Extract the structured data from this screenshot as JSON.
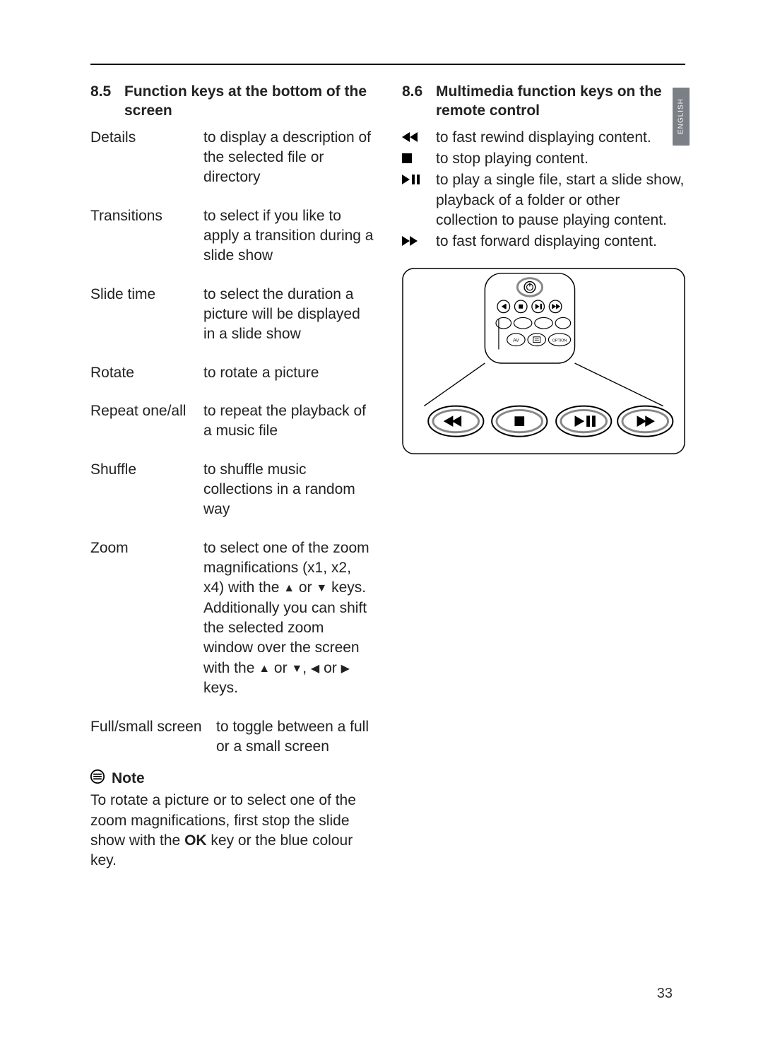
{
  "language_tab": "ENGLISH",
  "page_number": "33",
  "left": {
    "section_number": "8.5",
    "section_title": "Function keys at the bottom of the screen",
    "items": [
      {
        "term": "Details",
        "desc": "to display a description of the selected file or directory"
      },
      {
        "term": "Transitions",
        "desc": "to select if you like to apply a transition during a slide show"
      },
      {
        "term": "Slide time",
        "desc": "to select the duration a picture will be displayed in a slide show"
      },
      {
        "term": "Rotate",
        "desc": "to rotate a picture"
      },
      {
        "term": "Repeat one/all",
        "desc": "to repeat the playback of a music file"
      },
      {
        "term": "Shuffle",
        "desc": "to shuffle music collections in a random way"
      },
      {
        "term": "Zoom",
        "desc_parts": {
          "pre": "to select one of the zoom magnifications (x1, x2, x4) with the ",
          "up": "▲",
          "or1": " or ",
          "down": "▼",
          "post1": " keys. Additionally you can shift the selected zoom window over the screen with the ",
          "up2": "▲",
          "or2": " or ",
          "down2": "▼",
          "comma": ", ",
          "left": "◀",
          "or3": " or ",
          "right": "▶",
          "post2": " keys."
        }
      },
      {
        "term": "Full/small screen",
        "desc": "to toggle between a full or a small screen"
      }
    ],
    "note_label": "Note",
    "note_body_pre": "To rotate a picture or to select one of the zoom magnifications, first stop the slide show with the ",
    "note_ok": "OK",
    "note_body_post": " key or the blue colour key."
  },
  "right": {
    "section_number": "8.6",
    "section_title": "Multimedia function keys on the remote control",
    "items": [
      {
        "icon": "rewind",
        "text": "to fast rewind displaying content."
      },
      {
        "icon": "stop",
        "text": "to stop playing content."
      },
      {
        "icon": "playpause",
        "text": "to play a single file, start a slide show, playback of a folder or other collection to pause playing content."
      },
      {
        "icon": "forward",
        "text": "to fast forward displaying content."
      }
    ],
    "remote_small_labels": {
      "av": "AV",
      "option": "OPTION"
    }
  }
}
